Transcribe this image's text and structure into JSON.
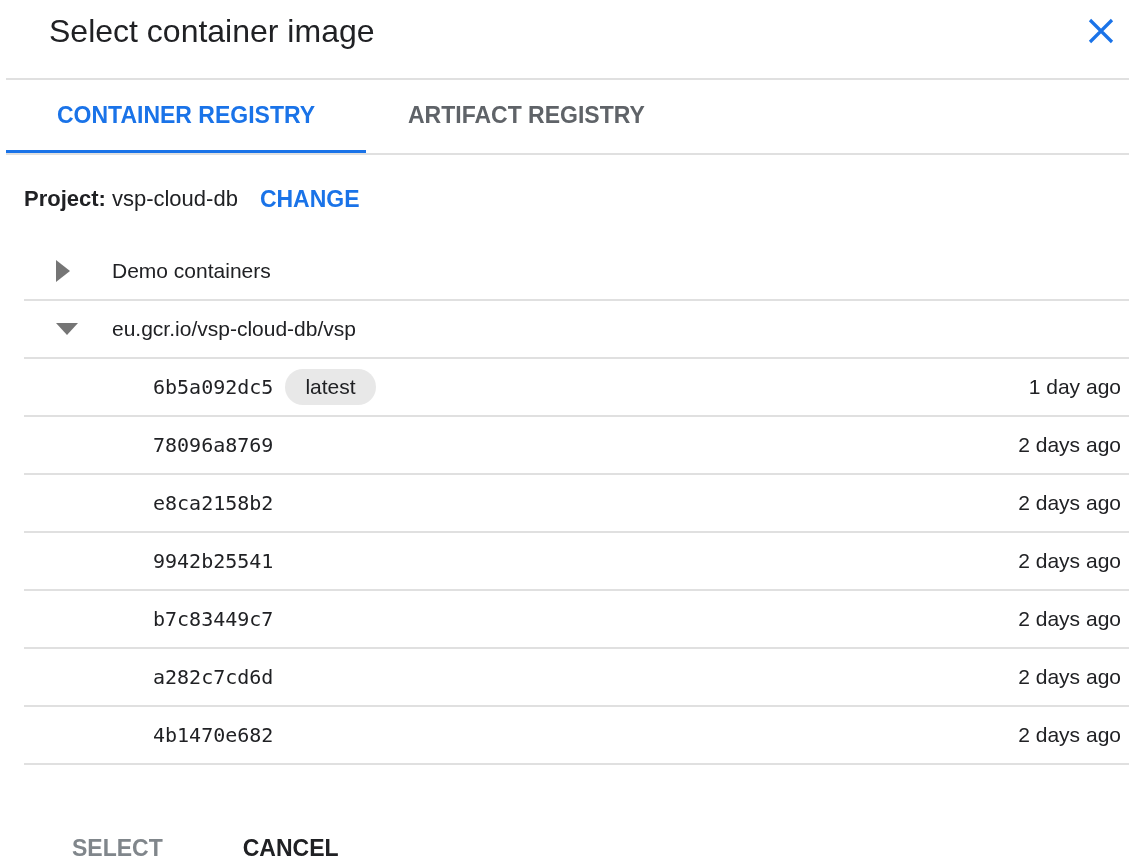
{
  "dialog": {
    "title": "Select container image"
  },
  "tabs": [
    {
      "label": "CONTAINER REGISTRY",
      "selected": true
    },
    {
      "label": "ARTIFACT REGISTRY",
      "selected": false
    }
  ],
  "project": {
    "label": "Project:",
    "value": "vsp-cloud-db",
    "action": "CHANGE"
  },
  "tree": [
    {
      "name": "Demo containers",
      "expanded": false
    },
    {
      "name": "eu.gcr.io/vsp-cloud-db/vsp",
      "expanded": true,
      "children": [
        {
          "name": "6b5a092dc5",
          "tag": "latest",
          "age": "1 day ago"
        },
        {
          "name": "78096a8769",
          "age": "2 days ago"
        },
        {
          "name": "e8ca2158b2",
          "age": "2 days ago"
        },
        {
          "name": "9942b25541",
          "age": "2 days ago"
        },
        {
          "name": "b7c83449c7",
          "age": "2 days ago"
        },
        {
          "name": "a282c7cd6d",
          "age": "2 days ago"
        },
        {
          "name": "4b1470e682",
          "age": "2 days ago"
        }
      ]
    }
  ],
  "buttons": [
    {
      "label": "SELECT",
      "disabled": true
    },
    {
      "label": "CANCEL",
      "disabled": false
    }
  ]
}
